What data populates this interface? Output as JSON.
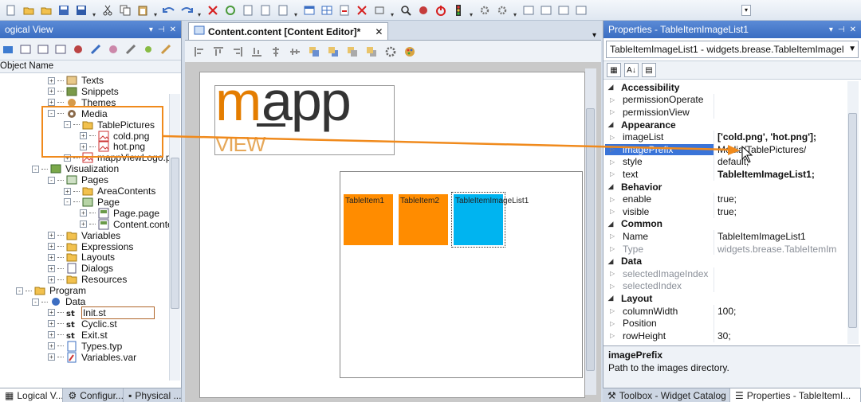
{
  "left_panel": {
    "title": "ogical View",
    "column_header": "Object Name",
    "tree": [
      {
        "label": "Texts"
      },
      {
        "label": "Snippets"
      },
      {
        "label": "Themes"
      },
      {
        "label": "Media"
      },
      {
        "label": "TablePictures"
      },
      {
        "label": "cold.png"
      },
      {
        "label": "hot.png"
      },
      {
        "label": "mappViewLogo.p"
      },
      {
        "label": "Visualization"
      },
      {
        "label": "Pages"
      },
      {
        "label": "AreaContents"
      },
      {
        "label": "Page"
      },
      {
        "label": "Page.page"
      },
      {
        "label": "Content.conte"
      },
      {
        "label": "Variables"
      },
      {
        "label": "Expressions"
      },
      {
        "label": "Layouts"
      },
      {
        "label": "Dialogs"
      },
      {
        "label": "Resources"
      },
      {
        "label": "Program"
      },
      {
        "label": "Data"
      },
      {
        "label": "Init.st"
      },
      {
        "label": "Cyclic.st"
      },
      {
        "label": "Exit.st"
      },
      {
        "label": "Types.typ"
      },
      {
        "label": "Variables.var"
      }
    ],
    "bottom_tabs": [
      "Logical V...",
      "Configur...",
      "Physical ..."
    ]
  },
  "editor": {
    "tab_label": "Content.content [Content Editor]*",
    "logo": {
      "m": "m",
      "app": "app",
      "view": "VIEW"
    },
    "widgets": [
      {
        "label": "TableItem1",
        "color": "#ff8c00"
      },
      {
        "label": "TableItem2",
        "color": "#ff8c00"
      },
      {
        "label": "TableItemImageList1",
        "color": "#00b4f0"
      }
    ]
  },
  "properties": {
    "title": "Properties - TableItemImageList1",
    "object_selector": "TableItemImageList1 - widgets.brease.TableItemImagel",
    "rows": [
      {
        "kind": "cat",
        "name": "Accessibility"
      },
      {
        "kind": "prop",
        "name": "permissionOperate",
        "value": ""
      },
      {
        "kind": "prop",
        "name": "permissionView",
        "value": ""
      },
      {
        "kind": "cat",
        "name": "Appearance"
      },
      {
        "kind": "prop",
        "name": "imageList",
        "value": "['cold.png', 'hot.png'];"
      },
      {
        "kind": "prop",
        "name": "imagePrefix",
        "value": "Media/TablePictures/"
      },
      {
        "kind": "prop",
        "name": "style",
        "value": "default;"
      },
      {
        "kind": "prop",
        "name": "text",
        "value": "TableItemImageList1;"
      },
      {
        "kind": "cat",
        "name": "Behavior"
      },
      {
        "kind": "prop",
        "name": "enable",
        "value": "true;"
      },
      {
        "kind": "prop",
        "name": "visible",
        "value": "true;"
      },
      {
        "kind": "cat",
        "name": "Common"
      },
      {
        "kind": "prop",
        "name": "Name",
        "value": "TableItemImageList1"
      },
      {
        "kind": "prop",
        "name": "Type",
        "value": "widgets.brease.TableItemIm"
      },
      {
        "kind": "cat",
        "name": "Data"
      },
      {
        "kind": "prop",
        "name": "selectedImageIndex",
        "value": ""
      },
      {
        "kind": "prop",
        "name": "selectedIndex",
        "value": ""
      },
      {
        "kind": "cat",
        "name": "Layout"
      },
      {
        "kind": "prop",
        "name": "columnWidth",
        "value": "100;"
      },
      {
        "kind": "prop",
        "name": "Position",
        "value": ""
      },
      {
        "kind": "prop",
        "name": "rowHeight",
        "value": "30;"
      }
    ],
    "description": {
      "title": "imagePrefix",
      "text": "Path to the images directory."
    },
    "bottom_tabs": [
      "Toolbox - Widget Catalog",
      "Properties - TableItemI..."
    ]
  },
  "colors": {
    "accent_orange": "#f08a1c",
    "selection_blue": "#3a74d8",
    "widget_orange": "#ff8c00",
    "widget_blue": "#00b4f0"
  }
}
